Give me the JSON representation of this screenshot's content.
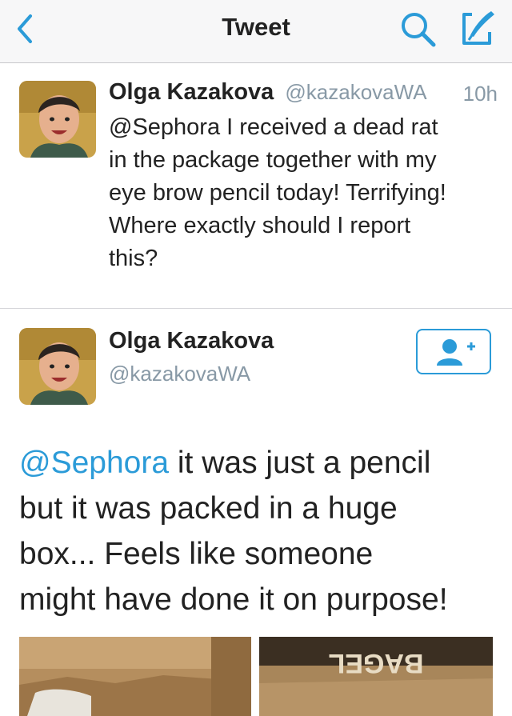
{
  "nav": {
    "title": "Tweet",
    "back_icon": "chevron-left-icon",
    "search_icon": "search-icon",
    "compose_icon": "compose-icon"
  },
  "colors": {
    "accent": "#2b9bd8",
    "text": "#222222",
    "muted": "#8899a6"
  },
  "tweet1": {
    "name": "Olga Kazakova",
    "handle": "@kazakovaWA",
    "time": "10h",
    "lines": [
      "@Sephora I received a dead rat",
      "in the package together with my",
      "eye brow pencil today! Terrifying!",
      "Where exactly should I report",
      "this?"
    ]
  },
  "tweet2": {
    "name": "Olga Kazakova",
    "handle": "@kazakovaWA",
    "follow_icon": "add-user-icon",
    "mention": "@Sephora",
    "line1_rest": " it was just a pencil",
    "line2": "but it was packed in a huge",
    "line3": "box... Feels like someone",
    "line4": "might have done it on purpose!",
    "media_2_text": "BAGEL"
  }
}
